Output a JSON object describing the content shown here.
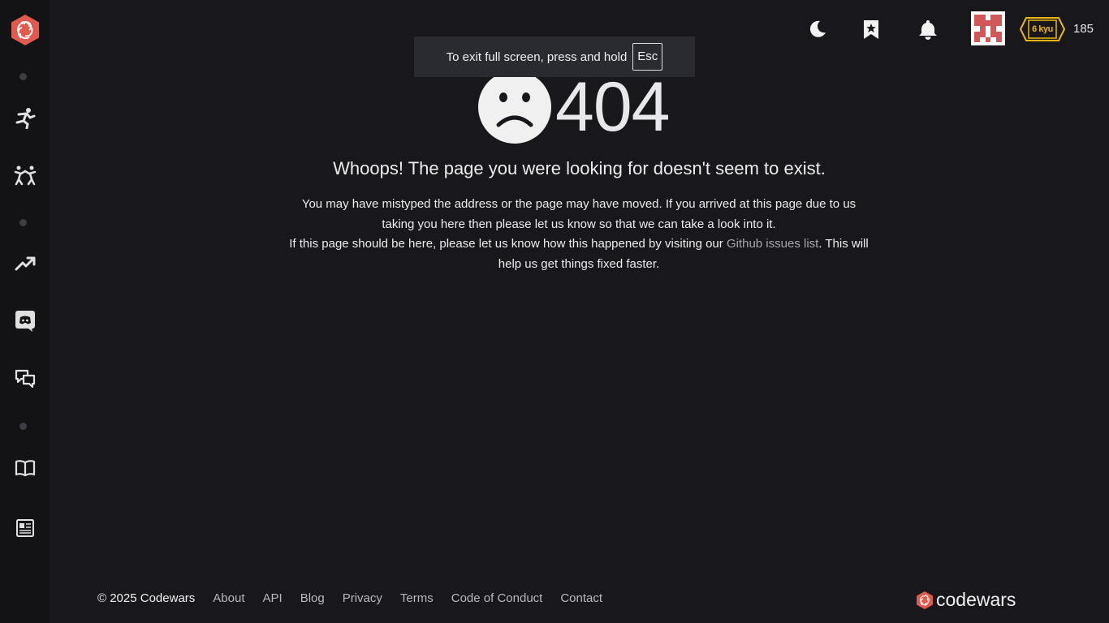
{
  "sidebar": {
    "logo_icon": "codewars-logo-icon",
    "items": [
      {
        "name": "training-icon",
        "label": "Training"
      },
      {
        "name": "practice-icon",
        "label": "Practice"
      },
      {
        "name": "leaderboards-icon",
        "label": "Leaderboards"
      },
      {
        "name": "discord-icon",
        "label": "Discord"
      },
      {
        "name": "discussions-icon",
        "label": "Discussions"
      },
      {
        "name": "docs-icon",
        "label": "Docs"
      },
      {
        "name": "blog-icon",
        "label": "Blog"
      }
    ]
  },
  "topbar": {
    "theme_icon": "moon-icon",
    "bookmark_icon": "bookmark-star-icon",
    "notification_icon": "bell-icon",
    "rank": "6 kyu",
    "honor": "185"
  },
  "fullscreen_notice": {
    "text": "To exit full screen, press and hold",
    "key": "Esc"
  },
  "error": {
    "code": "404",
    "headline": "Whoops! The page you were looking for doesn't seem to exist.",
    "line1": "You may have mistyped the address or the page may have moved. If you arrived at this page due to us taking you here then please let us know so that we can take a look into it.",
    "line2_pre": "If this page should be here, please let us know how this happened by visiting our ",
    "line2_link": "Github issues list",
    "line2_post": ". This will help us get things fixed faster."
  },
  "footer": {
    "copyright": "© 2025 Codewars",
    "links": [
      "About",
      "API",
      "Blog",
      "Privacy",
      "Terms",
      "Code of Conduct",
      "Contact"
    ],
    "logo_text": "codewars"
  },
  "colors": {
    "background": "#18181c",
    "sidebar": "#131316",
    "brand_red": "#e05a4e",
    "rank_yellow": "#ecb613"
  }
}
